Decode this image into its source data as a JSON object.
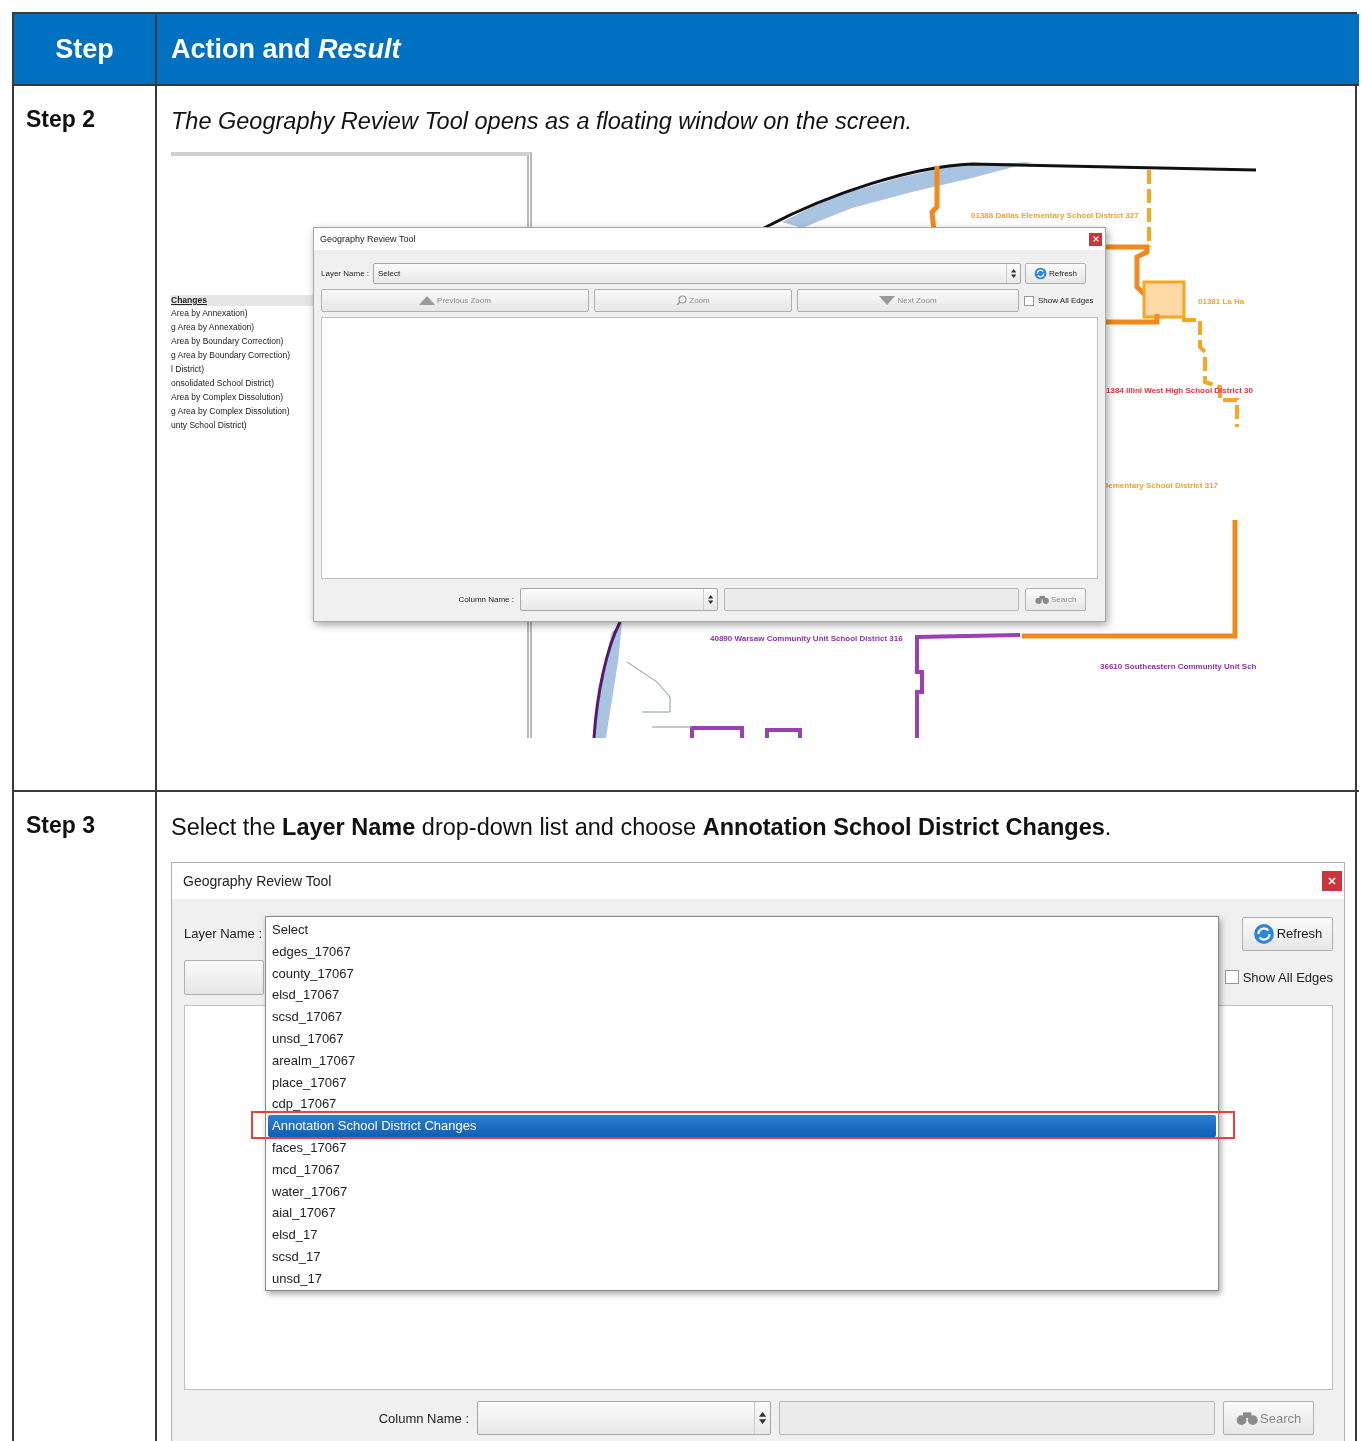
{
  "table": {
    "columns": [
      {
        "label": "Step"
      },
      {
        "label": "Action and *Result*"
      }
    ],
    "rows": [
      {
        "kind": "map_view",
        "step": "Step 2",
        "instruction": "The Geography Review Tool opens as a floating window on the screen.",
        "screenshot": {
          "legend": {
            "heading": "Changes",
            "items": [
              "Area by Annexation)",
              "g Area by Annexation)",
              "Area by Boundary Correction)",
              "g Area by Boundary Correction)",
              "l District)",
              "onsolidated School District)",
              "Area by Complex Dissolution)",
              "g Area by Complex Dissolution)",
              "unty School District)"
            ]
          },
          "map_labels": [
            {
              "text": "01388 Dallas Elementary School District 327",
              "color": "#f0a030"
            },
            {
              "text": "01381 La Ha",
              "color": "#f0a030"
            },
            {
              "text": "1384 Illini West High School District 30",
              "color": "#e8303a"
            },
            {
              "text": "lementary School District 317",
              "color": "#f0a030"
            },
            {
              "text": "40890 Warsaw Community Unit School District 316",
              "color": "#9030b0"
            },
            {
              "text": "36610 Southeastern Community Unit Sch",
              "color": "#9030b0"
            }
          ],
          "dialog": {
            "title": "Geography Review Tool",
            "layer_label": "Layer Name :",
            "layer_value": "Select",
            "refresh": "Refresh",
            "zoom_buttons": [
              "Previous Zoom",
              "Zoom",
              "Next Zoom"
            ],
            "show_all_edges": {
              "label": "Show All Edges",
              "checked": false
            },
            "column_label": "Column Name :",
            "search": "Search"
          }
        }
      },
      {
        "kind": "dropdown_view",
        "step": "Step 3",
        "instruction": "Select the **Layer Name** drop-down list and choose **Annotation School District Changes**.",
        "screenshot": {
          "dialog": {
            "title": "Geography Review Tool",
            "layer_label": "Layer Name :",
            "refresh": "Refresh",
            "show_all_edges": {
              "label": "Show All Edges",
              "checked": false
            },
            "column_label": "Column Name :",
            "search": "Search",
            "options": [
              {
                "label": "Select",
                "selected": false
              },
              {
                "label": "edges_17067",
                "selected": false
              },
              {
                "label": "county_17067",
                "selected": false
              },
              {
                "label": "elsd_17067",
                "selected": false
              },
              {
                "label": "scsd_17067",
                "selected": false
              },
              {
                "label": "unsd_17067",
                "selected": false
              },
              {
                "label": "arealm_17067",
                "selected": false
              },
              {
                "label": "place_17067",
                "selected": false
              },
              {
                "label": "cdp_17067",
                "selected": false
              },
              {
                "label": "Annotation School District Changes",
                "selected": true
              },
              {
                "label": "faces_17067",
                "selected": false
              },
              {
                "label": "mcd_17067",
                "selected": false
              },
              {
                "label": "water_17067",
                "selected": false
              },
              {
                "label": "aial_17067",
                "selected": false
              },
              {
                "label": "elsd_17",
                "selected": false
              },
              {
                "label": "scsd_17",
                "selected": false
              },
              {
                "label": "unsd_17",
                "selected": false
              }
            ]
          }
        }
      }
    ]
  }
}
